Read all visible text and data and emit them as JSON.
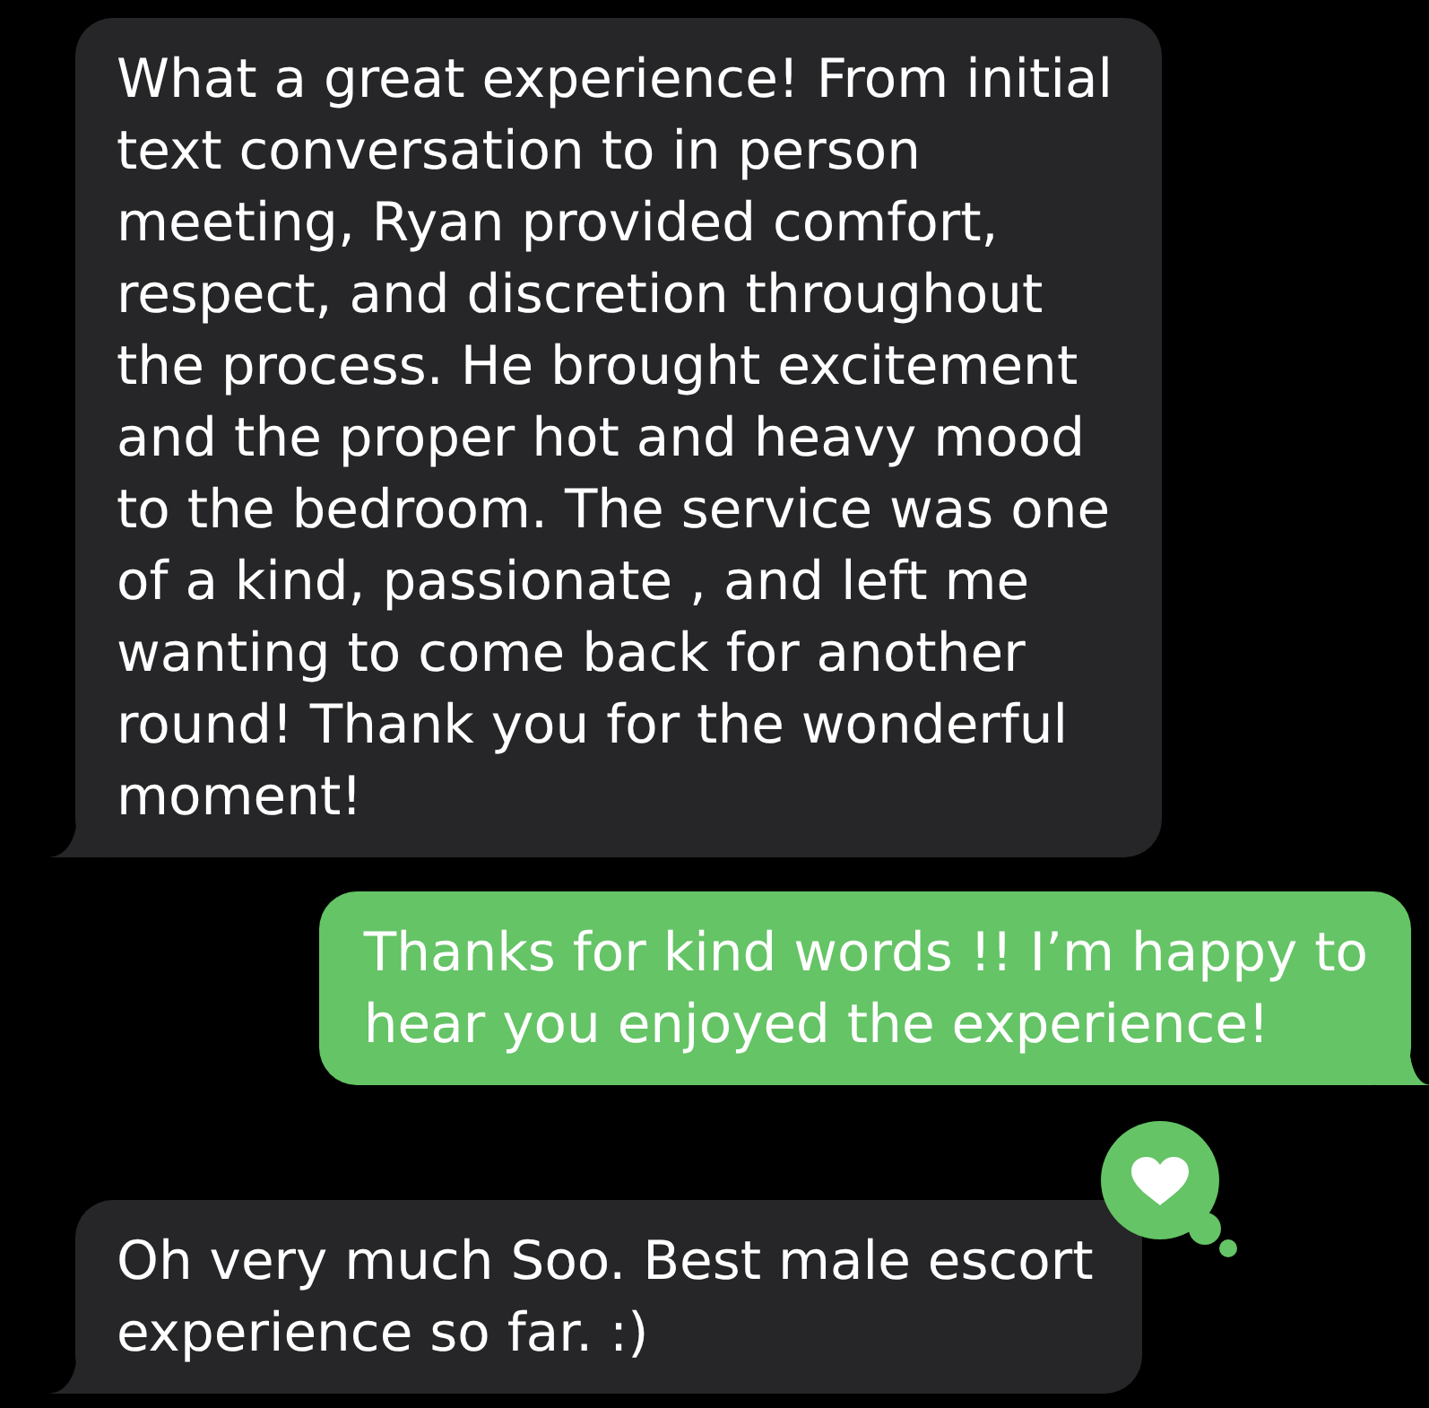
{
  "messages": [
    {
      "kind": "received",
      "text": "What a great experience! From initial\ntext conversation to in person\nmeeting, Ryan provided comfort,\nrespect, and discretion throughout\nthe process. He brought excitement\nand the proper hot and heavy mood\nto the bedroom. The service was one\nof a kind, passionate , and left me\nwanting to come back for another\nround! Thank you for the wonderful\nmoment!",
      "hearted": false
    },
    {
      "kind": "sent",
      "text": "Thanks for kind words !! I’m happy to\nhear you enjoyed the experience!",
      "hearted": false
    },
    {
      "kind": "received",
      "text": "Oh very much Soo. Best male escort\nexperience so far. :)",
      "hearted": true
    }
  ]
}
